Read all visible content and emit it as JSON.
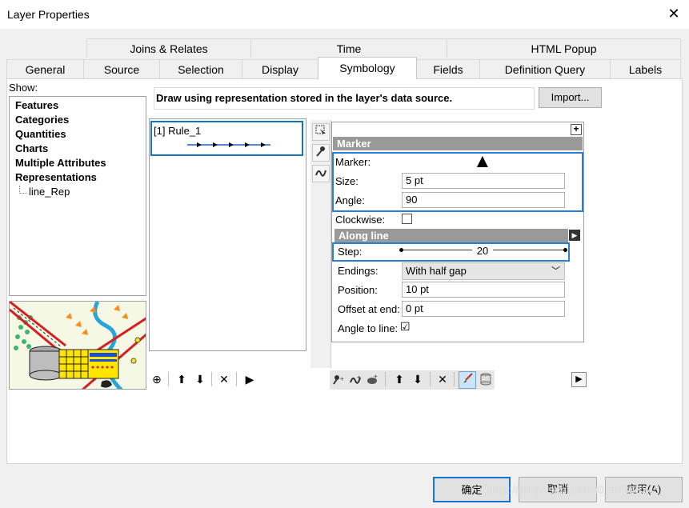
{
  "window": {
    "title": "Layer Properties",
    "close": "✕"
  },
  "tabs_row1": [
    "Joins & Relates",
    "Time",
    "HTML Popup"
  ],
  "tabs_row2": [
    "General",
    "Source",
    "Selection",
    "Display",
    "Symbology",
    "Fields",
    "Definition Query",
    "Labels"
  ],
  "selected_tab": "Symbology",
  "show": {
    "label": "Show:",
    "items": [
      "Features",
      "Categories",
      "Quantities",
      "Charts",
      "Multiple Attributes",
      "Representations"
    ],
    "sub_item": "line_Rep"
  },
  "description": "Draw using representation stored in the layer's data source.",
  "import_button": "Import...",
  "rules": [
    {
      "label": "[1] Rule_1"
    }
  ],
  "marker_panel": {
    "header": "Marker",
    "marker_label": "Marker:",
    "marker_symbol": "▲",
    "size_label": "Size:",
    "size_value": "5 pt",
    "angle_label": "Angle:",
    "angle_value": "90",
    "clockwise_label": "Clockwise:",
    "add_btn": "+"
  },
  "along_line": {
    "header": "Along line",
    "step_label": "Step:",
    "step_value": "20",
    "endings_label": "Endings:",
    "endings_value": "With half gap",
    "position_label": "Position:",
    "position_value": "10 pt",
    "offset_label": "Offset at end:",
    "offset_value": "0 pt",
    "angle_to_line_label": "Angle to line:",
    "angle_to_line_checked": "☑"
  },
  "left_tools": [
    "⊕",
    "⬆",
    "⬇",
    "✕",
    "▶"
  ],
  "right_tools": [
    "⬆",
    "⬇",
    "✕",
    "▶"
  ],
  "footer": {
    "ok": "确定",
    "cancel": "取消",
    "apply": "应用(A)"
  },
  "watermark": "https://blog.csdn.net/m0_45363345"
}
